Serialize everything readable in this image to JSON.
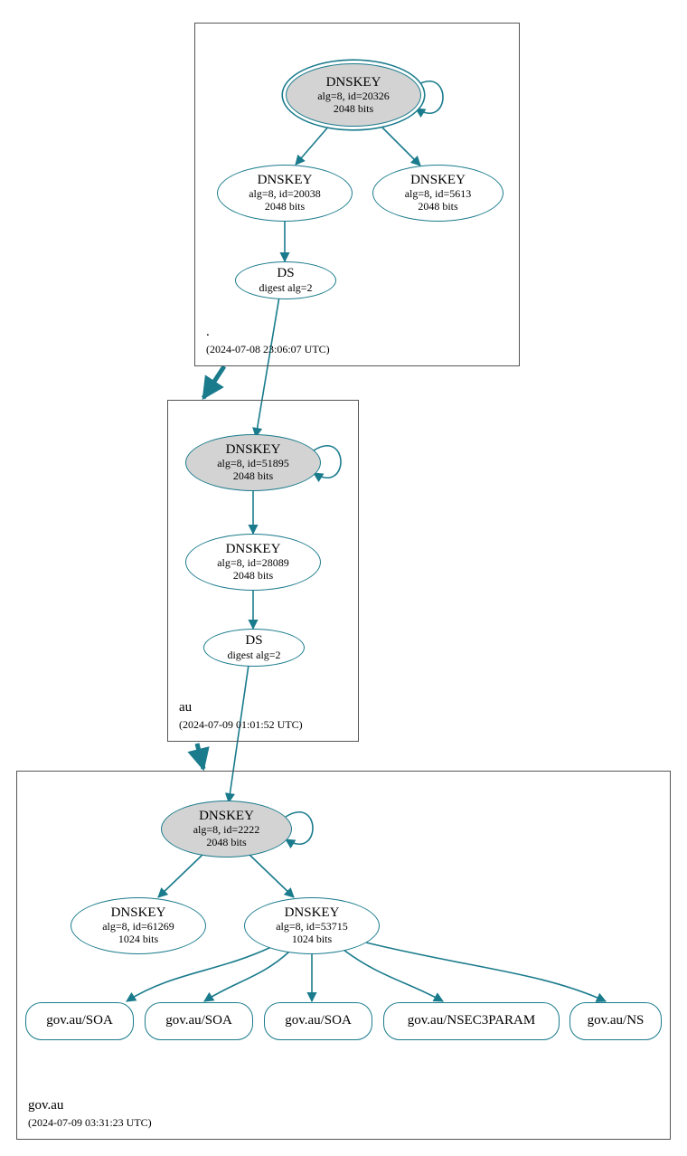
{
  "zones": {
    "root": {
      "name": ".",
      "timestamp": "(2024-07-08 23:06:07 UTC)"
    },
    "au": {
      "name": "au",
      "timestamp": "(2024-07-09 01:01:52 UTC)"
    },
    "govau": {
      "name": "gov.au",
      "timestamp": "(2024-07-09 03:31:23 UTC)"
    }
  },
  "nodes": {
    "root_ksk": {
      "title": "DNSKEY",
      "line1": "alg=8, id=20326",
      "line2": "2048 bits"
    },
    "root_zsk1": {
      "title": "DNSKEY",
      "line1": "alg=8, id=20038",
      "line2": "2048 bits"
    },
    "root_zsk2": {
      "title": "DNSKEY",
      "line1": "alg=8, id=5613",
      "line2": "2048 bits"
    },
    "root_ds": {
      "title": "DS",
      "line1": "digest alg=2"
    },
    "au_ksk": {
      "title": "DNSKEY",
      "line1": "alg=8, id=51895",
      "line2": "2048 bits"
    },
    "au_zsk": {
      "title": "DNSKEY",
      "line1": "alg=8, id=28089",
      "line2": "2048 bits"
    },
    "au_ds": {
      "title": "DS",
      "line1": "digest alg=2"
    },
    "govau_ksk": {
      "title": "DNSKEY",
      "line1": "alg=8, id=2222",
      "line2": "2048 bits"
    },
    "govau_zsk1": {
      "title": "DNSKEY",
      "line1": "alg=8, id=61269",
      "line2": "1024 bits"
    },
    "govau_zsk2": {
      "title": "DNSKEY",
      "line1": "alg=8, id=53715",
      "line2": "1024 bits"
    },
    "rr_soa1": {
      "title": "gov.au/SOA"
    },
    "rr_soa2": {
      "title": "gov.au/SOA"
    },
    "rr_soa3": {
      "title": "gov.au/SOA"
    },
    "rr_nsec3": {
      "title": "gov.au/NSEC3PARAM"
    },
    "rr_ns": {
      "title": "gov.au/NS"
    }
  },
  "colors": {
    "stroke": "#1a7b8c"
  }
}
